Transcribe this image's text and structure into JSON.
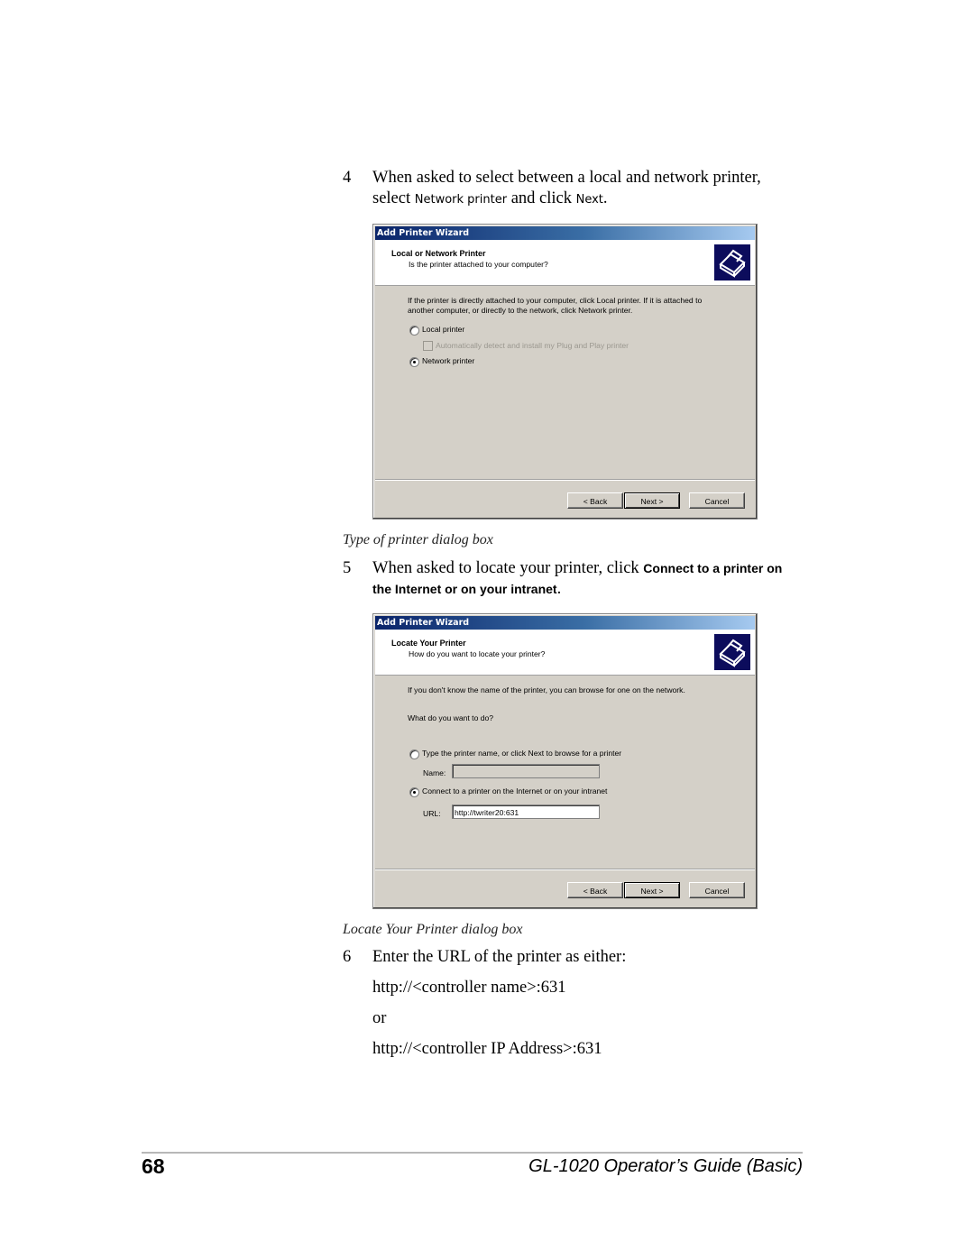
{
  "steps": [
    {
      "number": "4",
      "line1": "When asked to select between a local and network printer,",
      "line2_pre": "select ",
      "line2_ui1": "Network printer",
      "line2_mid": " and click ",
      "line2_ui2": "Next",
      "line2_post": "."
    },
    {
      "number": "5",
      "line1_pre": "When asked to locate your printer, click ",
      "line1_ui": "Connect to a printer on",
      "line2_ui": "the Internet or on your intranet",
      "line2_post": "."
    },
    {
      "number": "6",
      "line1": "Enter the URL of the printer as either:",
      "option1": "http://<controller name>:631",
      "or": "or",
      "option2": "http://<controller IP Address>:631"
    }
  ],
  "dialog1": {
    "window_title": "Add Printer Wizard",
    "header_title": "Local or Network Printer",
    "header_subtitle": "Is the printer attached to your computer?",
    "icon": "printer-icon",
    "description_line1": "If the printer is directly attached to your computer, click Local printer.  If it is attached to",
    "description_line2": "another computer, or directly to the network, click Network printer.",
    "radio_local": {
      "label": "Local printer",
      "checked": false
    },
    "checkbox_plug_and_play": {
      "label": "Automatically detect and install my Plug and Play printer",
      "checked": false,
      "disabled": true
    },
    "radio_network": {
      "label": "Network printer",
      "checked": true
    },
    "buttons": {
      "back": "< Back",
      "next": "Next >",
      "cancel": "Cancel"
    },
    "caption": "Type of printer dialog box"
  },
  "dialog2": {
    "window_title": "Add Printer Wizard",
    "header_title": "Locate Your Printer",
    "header_subtitle": "How do you want to locate your printer?",
    "icon": "printer-icon",
    "description": "If you don't know the name of the printer, you can browse for one on the network.",
    "question": "What do you want to do?",
    "radio_type_name": {
      "label": "Type the printer name, or click Next to browse for a printer",
      "checked": false
    },
    "name_label": "Name:",
    "name_value": "",
    "radio_connect": {
      "label": "Connect to a printer on the Internet or on your intranet",
      "checked": true
    },
    "url_label": "URL:",
    "url_value": "http://twriter20:631",
    "buttons": {
      "back": "< Back",
      "next": "Next >",
      "cancel": "Cancel"
    },
    "caption": "Locate Your Printer dialog box"
  },
  "footer": {
    "page_number": "68",
    "guide_title": "GL-1020 Operator’s Guide (Basic)"
  }
}
